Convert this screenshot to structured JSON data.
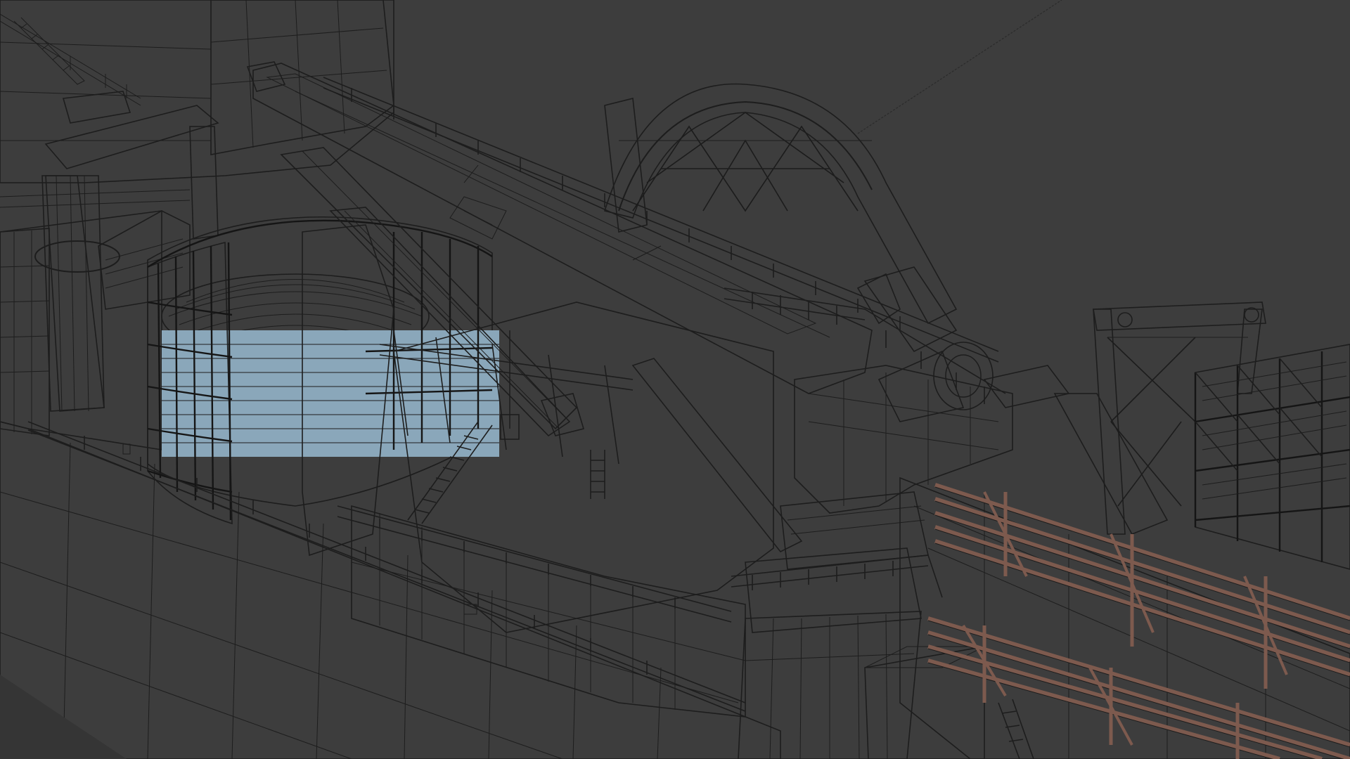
{
  "colors": {
    "background": "#3d3d3d",
    "hull": "#8fb79a",
    "deck": "#9fcab0",
    "superstructure": "#a8c49a",
    "crane": "#9f8fc4",
    "crane_dark": "#7f70a8",
    "carousel": "#c7879c",
    "cable": "#8aa7ba",
    "platform": "#b9b083",
    "pedestal": "#8a9eae",
    "gantry_frame": "#c99f86",
    "pipe_rack": "#7d5a4e",
    "pipe_bundle": "#9fc6cf",
    "wire": "#1d1d1d"
  },
  "scene": {
    "objects": [
      {
        "id": "hull",
        "icon": "ship-hull-icon"
      },
      {
        "id": "main-deck",
        "icon": "deck-icon"
      },
      {
        "id": "superstructure",
        "icon": "building-icon"
      },
      {
        "id": "cable-carousel",
        "icon": "reel-icon"
      },
      {
        "id": "work-platform",
        "icon": "platform-icon"
      },
      {
        "id": "knuckle-boom-crane",
        "icon": "crane-icon"
      },
      {
        "id": "crane-pedestal",
        "icon": "pillar-icon"
      },
      {
        "id": "a-frame-crane",
        "icon": "crane-icon"
      },
      {
        "id": "lay-wheel-arch",
        "icon": "wheel-icon"
      },
      {
        "id": "aft-gantry",
        "icon": "gantry-icon"
      },
      {
        "id": "pipe-rack",
        "icon": "rack-icon"
      },
      {
        "id": "pipe-storage",
        "icon": "pipes-icon"
      }
    ]
  }
}
